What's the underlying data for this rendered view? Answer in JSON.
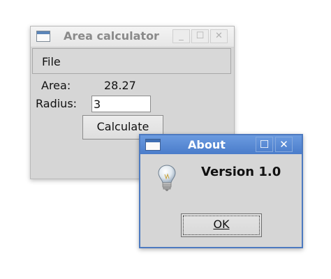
{
  "main_window": {
    "title": "Area calculator",
    "controls": {
      "minimize": "_",
      "maximize": "☐",
      "close": "✕"
    },
    "menu": {
      "file_label": "File"
    },
    "area_label": "Area:",
    "area_value": "28.27",
    "radius_label": "Radius:",
    "radius_value": "3",
    "calculate_label": "Calculate"
  },
  "about_dialog": {
    "title": "About",
    "controls": {
      "maximize": "☐",
      "close": "✕"
    },
    "version_text": "Version 1.0",
    "icon": "lightbulb-icon",
    "ok_label": "OK"
  },
  "colors": {
    "title_active": "#4a7cca",
    "window_bg": "#d6d6d6"
  }
}
